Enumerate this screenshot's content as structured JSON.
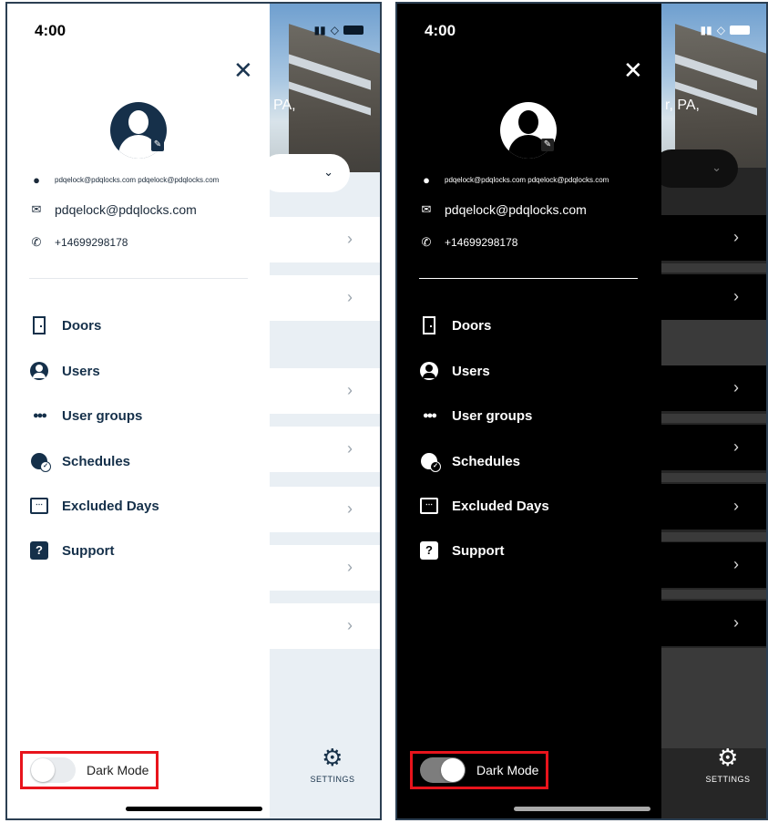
{
  "status": {
    "time": "4:00"
  },
  "profile": {
    "username": "pdqelock@pdqlocks.com pdqelock@pdqlocks.com",
    "email": "pdqelock@pdqlocks.com",
    "phone": "+14699298178"
  },
  "hero_text": {
    "light": "PA,",
    "dark": "r, PA,"
  },
  "menu": [
    {
      "label": "Doors",
      "icon": "door-icon"
    },
    {
      "label": "Users",
      "icon": "user-circle-icon"
    },
    {
      "label": "User groups",
      "icon": "user-group-icon"
    },
    {
      "label": "Schedules",
      "icon": "schedule-clock-icon"
    },
    {
      "label": "Excluded Days",
      "icon": "calendar-icon"
    },
    {
      "label": "Support",
      "icon": "help-icon"
    }
  ],
  "toggle": {
    "label": "Dark Mode"
  },
  "settings": {
    "label": "SETTINGS"
  },
  "colors": {
    "highlight": "#e8141c",
    "navy": "#15304a"
  }
}
